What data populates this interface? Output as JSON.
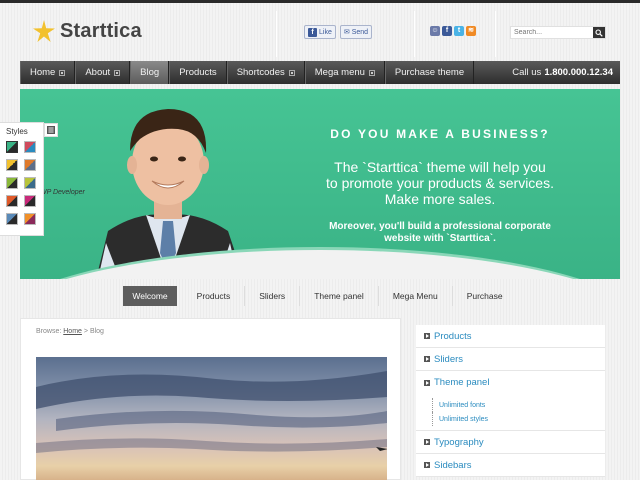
{
  "header": {
    "logo_text": "Starttica",
    "like_label": "Like",
    "send_label": "Send",
    "search_placeholder": "Search..."
  },
  "nav": {
    "items": [
      {
        "label": "Home",
        "has_submenu": true
      },
      {
        "label": "About",
        "has_submenu": true
      },
      {
        "label": "Blog",
        "has_submenu": false,
        "active": true
      },
      {
        "label": "Products",
        "has_submenu": false
      },
      {
        "label": "Shortcodes",
        "has_submenu": true
      },
      {
        "label": "Mega menu",
        "has_submenu": true
      },
      {
        "label": "Purchase theme",
        "has_submenu": false
      }
    ],
    "call_label": "Call us",
    "call_number": "1.800.000.12.34"
  },
  "hero": {
    "headline": "DO YOU MAKE A BUSINESS?",
    "line1": "The `Starttica` theme will help you",
    "line2": "to promote your products & services.",
    "line3": "Make more sales.",
    "sub1": "Moreover, you'll build a professional corporate",
    "sub2": "website with `Starttica`.",
    "person_label": "WP Developer"
  },
  "styles_panel": {
    "label": "Styles"
  },
  "subnav": {
    "items": [
      "Welcome",
      "Products",
      "Sliders",
      "Theme panel",
      "Mega Menu",
      "Purchase"
    ]
  },
  "content": {
    "breadcrumb_prefix": "Browse:",
    "breadcrumb_home": "Home",
    "breadcrumb_sep": ">",
    "breadcrumb_current": "Blog"
  },
  "sidebar": {
    "items": [
      "Products",
      "Sliders",
      "Theme panel",
      "Typography",
      "Sidebars"
    ],
    "sub_items": [
      "Unlimited fonts",
      "Unlimited styles"
    ]
  },
  "colors": {
    "hero_green": "#3ab386",
    "nav_dark": "#3a3a3a",
    "link_blue": "#2a8bbf",
    "logo_star": "#f2c12e"
  }
}
